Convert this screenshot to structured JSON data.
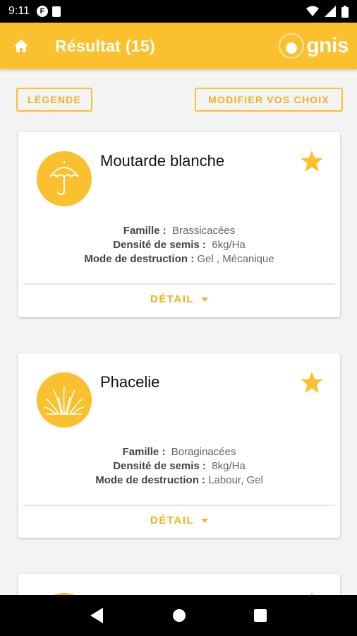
{
  "status_bar": {
    "time": "9:11",
    "app_icon_letter": "F"
  },
  "app_bar": {
    "title": "Résultat (15)",
    "logo_text": "gnis"
  },
  "actions": {
    "legend_label": "LÉGENDE",
    "modify_label": "MODIFIER VOS CHOIX"
  },
  "labels": {
    "famille": "Famille :",
    "densite": "Densité de semis :",
    "mode": "Mode de destruction :",
    "detail": "DÉTAIL"
  },
  "cards": [
    {
      "name": "Moutarde blanche",
      "icon": "umbrella-icon",
      "famille": "Brassicacées",
      "densite": "6kg/Ha",
      "mode": "Gel , Mécanique"
    },
    {
      "name": "Phacelie",
      "icon": "grass-icon",
      "famille": "Boraginacées",
      "densite": "8kg/Ha",
      "mode": "Labour, Gel"
    }
  ],
  "colors": {
    "accent": "#FBC02D",
    "accent_text": "#F2B21C"
  }
}
